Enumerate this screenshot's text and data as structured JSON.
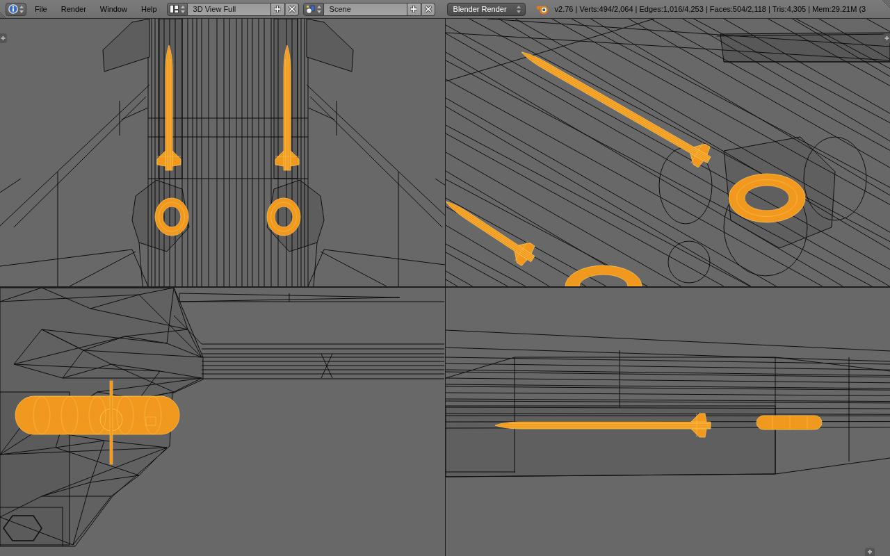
{
  "header": {
    "menus": [
      "File",
      "Render",
      "Window",
      "Help"
    ],
    "screen_layout": {
      "value": "3D View Full"
    },
    "scene": {
      "value": "Scene"
    },
    "render_engine": "Blender Render",
    "stats": "v2.76 | Verts:494/2,064 | Edges:1,016/4,253 | Faces:504/2,118 | Tris:4,305 | Mem:29.21M (3"
  }
}
